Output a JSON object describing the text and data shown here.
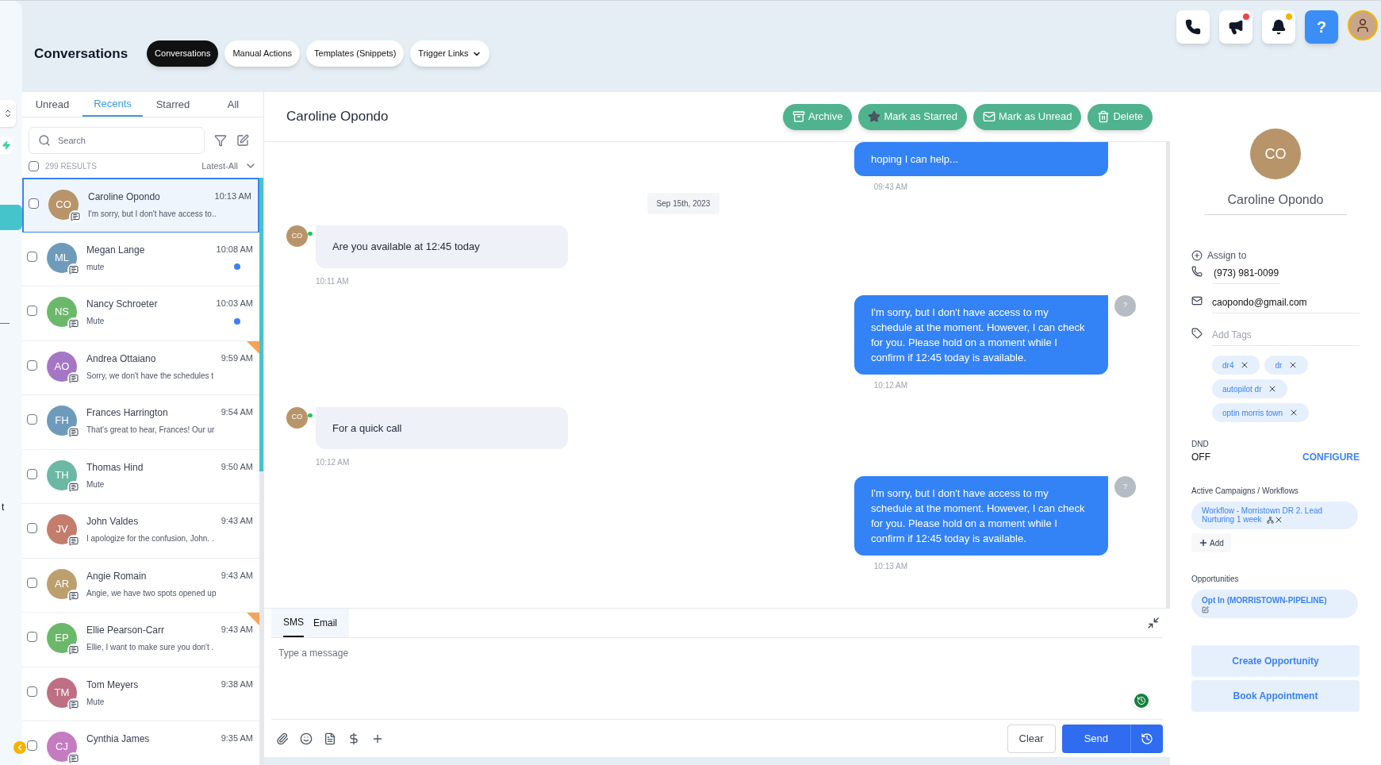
{
  "top_bar": {
    "title": "Conversations",
    "tabs": [
      {
        "label": "Conversations",
        "selected": true,
        "dropdown": false
      },
      {
        "label": "Manual Actions",
        "selected": false,
        "dropdown": false
      },
      {
        "label": "Templates (Snippets)",
        "selected": false,
        "dropdown": false
      },
      {
        "label": "Trigger Links",
        "selected": false,
        "dropdown": true
      }
    ],
    "icons": [
      {
        "kind": "phone"
      },
      {
        "kind": "megaphone",
        "color": "#ef4444"
      },
      {
        "kind": "bell",
        "color": "#f5b301"
      },
      {
        "kind": "help",
        "label": "?"
      }
    ]
  },
  "left_rail": {
    "fragment": "t"
  },
  "list": {
    "tabs": [
      {
        "label": "Unread",
        "selected": false
      },
      {
        "label": "Recents",
        "selected": true
      },
      {
        "label": "Starred",
        "selected": false
      },
      {
        "label": "All",
        "selected": false
      }
    ],
    "search": {
      "placeholder": "Search"
    },
    "all_checked": false,
    "results": "299 RESULTS",
    "sort": "Latest-All",
    "conversations": [
      {
        "initials": "CO",
        "name": "Caroline Opondo",
        "time": "10:13 AM",
        "preview": "I'm sorry, but I don't have access to..",
        "color": "#b8946a",
        "selected": true,
        "unread": false,
        "starred": false
      },
      {
        "initials": "ML",
        "name": "Megan Lange",
        "time": "10:08 AM",
        "preview": "mute",
        "color": "#6f9bbb",
        "selected": false,
        "unread": true,
        "starred": false
      },
      {
        "initials": "NS",
        "name": "Nancy Schroeter",
        "time": "10:03 AM",
        "preview": "Mute",
        "color": "#6bb86a",
        "selected": false,
        "unread": true,
        "starred": false
      },
      {
        "initials": "AO",
        "name": "Andrea Ottaiano",
        "time": "9:59 AM",
        "preview": "Sorry, we don't have the schedules t",
        "color": "#a477c4",
        "selected": false,
        "unread": false,
        "starred": true
      },
      {
        "initials": "FH",
        "name": "Frances Harrington",
        "time": "9:54 AM",
        "preview": "That's great to hear, Frances! Our ur",
        "color": "#6f9bbb",
        "selected": false,
        "unread": false,
        "starred": false
      },
      {
        "initials": "TH",
        "name": "Thomas Hind",
        "time": "9:50 AM",
        "preview": "Mute",
        "color": "#6cb8a4",
        "selected": false,
        "unread": false,
        "starred": false
      },
      {
        "initials": "JV",
        "name": "John Valdes",
        "time": "9:43 AM",
        "preview": "I apologize for the confusion, John. .",
        "color": "#c27d6c",
        "selected": false,
        "unread": false,
        "starred": false
      },
      {
        "initials": "AR",
        "name": "Angie Romain",
        "time": "9:43 AM",
        "preview": "Angie, we have two spots opened up",
        "color": "#bba06e",
        "selected": false,
        "unread": false,
        "starred": false
      },
      {
        "initials": "EP",
        "name": "Ellie Pearson-Carr",
        "time": "9:43 AM",
        "preview": "Ellie, I want to make sure you don't .",
        "color": "#6bb86a",
        "selected": false,
        "unread": false,
        "starred": true
      },
      {
        "initials": "TM",
        "name": "Tom Meyers",
        "time": "9:38 AM",
        "preview": "Mute",
        "color": "#be6f83",
        "selected": false,
        "unread": false,
        "starred": false
      },
      {
        "initials": "CJ",
        "name": "Cynthia James",
        "time": "9:35 AM",
        "color": "#c47bc0",
        "selected": false,
        "unread": false,
        "starred": false
      }
    ]
  },
  "chat": {
    "contact": "Caroline Opondo",
    "actions": [
      {
        "kind": "archive",
        "label": "Archive"
      },
      {
        "kind": "star",
        "label": "Mark as Starred"
      },
      {
        "kind": "mail",
        "label": "Mark as Unread"
      },
      {
        "kind": "trash",
        "label": "Delete"
      }
    ],
    "messages": [
      {
        "kind": "outbound",
        "text": "hoping I can help...",
        "time": "09:43 AM"
      },
      {
        "kind": "date",
        "text": "Sep 15th, 2023"
      },
      {
        "kind": "inbound",
        "initials": "CO",
        "text": "Are you available at 12:45 today",
        "time": "10:11 AM"
      },
      {
        "kind": "outbound",
        "text": "I'm sorry, but I don't have access to my schedule at the moment. However, I can check for you. Please hold on a moment while I confirm if 12:45 today is available.",
        "time": "10:12 AM",
        "avatar": "?"
      },
      {
        "kind": "inbound",
        "initials": "CO",
        "text": "For a quick call",
        "time": "10:12 AM"
      },
      {
        "kind": "outbound",
        "text": "I'm sorry, but I don't have access to my schedule at the moment. However, I can check for you. Please hold on a moment while I confirm if 12:45 today is available.",
        "time": "10:13 AM",
        "avatar": "?"
      }
    ],
    "composer": {
      "tabs": [
        {
          "label": "SMS",
          "selected": true
        },
        {
          "label": "Email",
          "selected": false
        }
      ],
      "placeholder": "Type a message",
      "clear": "Clear",
      "send": "Send"
    }
  },
  "contact_panel": {
    "initials": "CO",
    "name": "Caroline Opondo",
    "assign": "Assign to",
    "phone": "(973) 981-0099",
    "email": "caopondo@gmail.com",
    "tags_placeholder": "Add Tags",
    "tags": [
      "dr4",
      "dr",
      "autopilot dr",
      "optin morris town"
    ],
    "dnd_label": "DND",
    "dnd_value": "OFF",
    "configure": "CONFIGURE",
    "campaigns_label": "Active Campaigns / Workflows",
    "campaigns": [
      "Workflow - Morristown DR 2. Lead Nurturing 1 week"
    ],
    "add": "Add",
    "opportunities_label": "Opportunities",
    "opportunities": [
      "Opt In (MORRISTOWN-PIPELINE)"
    ],
    "buttons": [
      "Create Opportunity",
      "Book Appointment"
    ]
  }
}
